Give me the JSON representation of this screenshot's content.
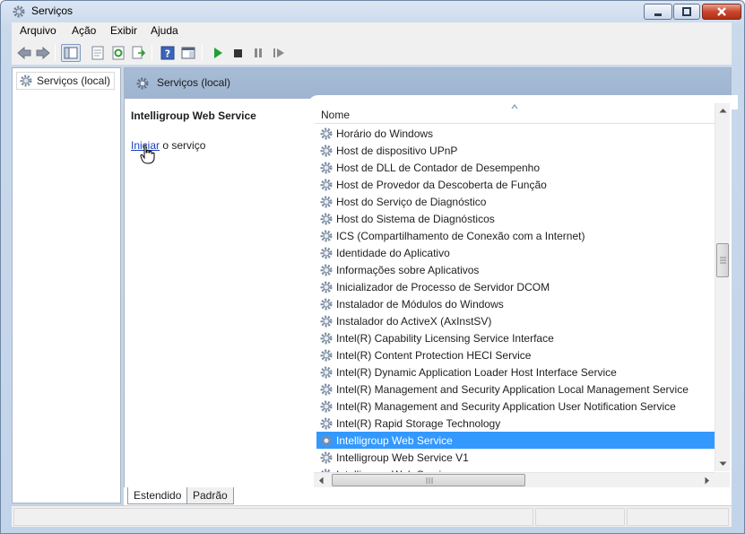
{
  "window": {
    "title": "Serviços"
  },
  "menu": [
    "Arquivo",
    "Ação",
    "Exibir",
    "Ajuda"
  ],
  "tree": {
    "item": "Serviços (local)"
  },
  "panel": {
    "header": "Serviços (local)",
    "service_name": "Intelligroup Web Service",
    "link_text": "Iniciar",
    "link_suffix": " o serviço"
  },
  "list": {
    "column": "Nome",
    "rows": [
      "Horário do Windows",
      "Host de dispositivo UPnP",
      "Host de DLL de Contador de Desempenho",
      "Host de Provedor da Descoberta de Função",
      "Host do Serviço de Diagnóstico",
      "Host do Sistema de Diagnósticos",
      "ICS (Compartilhamento de Conexão com a Internet)",
      "Identidade do Aplicativo",
      "Informações sobre Aplicativos",
      "Inicializador de Processo de Servidor DCOM",
      "Instalador de Módulos do Windows",
      "Instalador do ActiveX (AxInstSV)",
      "Intel(R) Capability Licensing Service Interface",
      "Intel(R) Content Protection HECI Service",
      "Intel(R) Dynamic Application Loader Host Interface Service",
      "Intel(R) Management and Security Application Local Management Service",
      "Intel(R) Management and Security Application User Notification Service",
      "Intel(R) Rapid Storage Technology",
      "Intelligroup Web Service",
      "Intelligroup Web Service V1",
      "Intelligroup Web Service"
    ],
    "selected_index": 18
  },
  "tabs": [
    "Estendido",
    "Padrão"
  ],
  "colors": {
    "selection": "#3399ff",
    "header": "#a7bcd6",
    "link": "#1a3ebe"
  },
  "icons": {
    "service": "gear-icon",
    "toolbar": [
      "back-icon",
      "forward-icon",
      "console-tree-icon",
      "properties-icon",
      "refresh-icon",
      "export-icon",
      "help-icon",
      "show-hide-icon",
      "start-icon",
      "stop-icon",
      "pause-icon",
      "resume-icon"
    ]
  }
}
